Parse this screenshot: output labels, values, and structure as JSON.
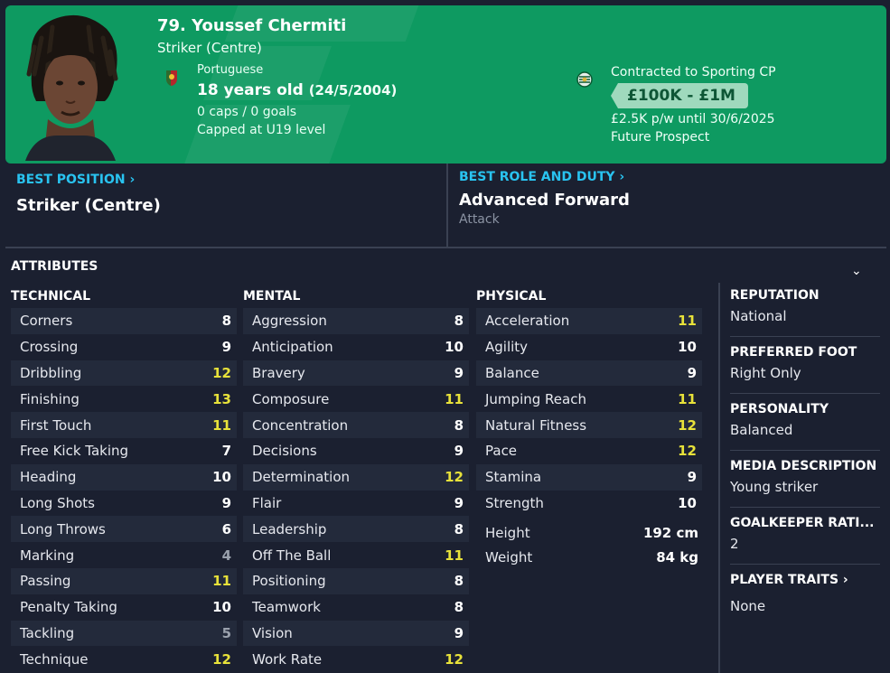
{
  "header": {
    "name": "79. Youssef Chermiti",
    "position": "Striker (Centre)",
    "nationality": "Portuguese",
    "age": "18 years old",
    "dob": "(24/5/2004)",
    "caps": "0 caps / 0 goals",
    "capped_level": "Capped at U19 level",
    "contract": "Contracted to Sporting CP",
    "value": "£100K - £1M",
    "wage": "£2.5K p/w until 30/6/2025",
    "status": "Future Prospect",
    "bg_color": "#0e9a61"
  },
  "best_position": {
    "title": "BEST POSITION",
    "value": "Striker (Centre)"
  },
  "best_role": {
    "title": "BEST ROLE AND DUTY",
    "value": "Advanced Forward",
    "duty": "Attack"
  },
  "attributes": {
    "title": "ATTRIBUTES",
    "technical": {
      "title": "TECHNICAL",
      "items": [
        {
          "label": "Corners",
          "value": "8"
        },
        {
          "label": "Crossing",
          "value": "9"
        },
        {
          "label": "Dribbling",
          "value": "12"
        },
        {
          "label": "Finishing",
          "value": "13"
        },
        {
          "label": "First Touch",
          "value": "11"
        },
        {
          "label": "Free Kick Taking",
          "value": "7"
        },
        {
          "label": "Heading",
          "value": "10"
        },
        {
          "label": "Long Shots",
          "value": "9"
        },
        {
          "label": "Long Throws",
          "value": "6"
        },
        {
          "label": "Marking",
          "value": "4"
        },
        {
          "label": "Passing",
          "value": "11"
        },
        {
          "label": "Penalty Taking",
          "value": "10"
        },
        {
          "label": "Tackling",
          "value": "5"
        },
        {
          "label": "Technique",
          "value": "12"
        }
      ]
    },
    "mental": {
      "title": "MENTAL",
      "items": [
        {
          "label": "Aggression",
          "value": "8"
        },
        {
          "label": "Anticipation",
          "value": "10"
        },
        {
          "label": "Bravery",
          "value": "9"
        },
        {
          "label": "Composure",
          "value": "11"
        },
        {
          "label": "Concentration",
          "value": "8"
        },
        {
          "label": "Decisions",
          "value": "9"
        },
        {
          "label": "Determination",
          "value": "12"
        },
        {
          "label": "Flair",
          "value": "9"
        },
        {
          "label": "Leadership",
          "value": "8"
        },
        {
          "label": "Off The Ball",
          "value": "11"
        },
        {
          "label": "Positioning",
          "value": "8"
        },
        {
          "label": "Teamwork",
          "value": "8"
        },
        {
          "label": "Vision",
          "value": "9"
        },
        {
          "label": "Work Rate",
          "value": "12"
        }
      ]
    },
    "physical": {
      "title": "PHYSICAL",
      "items": [
        {
          "label": "Acceleration",
          "value": "11"
        },
        {
          "label": "Agility",
          "value": "10"
        },
        {
          "label": "Balance",
          "value": "9"
        },
        {
          "label": "Jumping Reach",
          "value": "11"
        },
        {
          "label": "Natural Fitness",
          "value": "12"
        },
        {
          "label": "Pace",
          "value": "12"
        },
        {
          "label": "Stamina",
          "value": "9"
        },
        {
          "label": "Strength",
          "value": "10"
        }
      ],
      "height_label": "Height",
      "height": "192 cm",
      "weight_label": "Weight",
      "weight": "84 kg"
    }
  },
  "side": {
    "reputation_title": "REPUTATION",
    "reputation": "National",
    "foot_title": "PREFERRED FOOT",
    "foot": "Right Only",
    "personality_title": "PERSONALITY",
    "personality": "Balanced",
    "media_title": "MEDIA DESCRIPTION",
    "media": "Young striker",
    "gk_title": "GOALKEEPER RATI...",
    "gk": "2",
    "traits_title": "PLAYER TRAITS",
    "traits": "None"
  },
  "colors": {
    "highlight": "#e8e23a",
    "low": "#9aa1ad",
    "link": "#29c3f0"
  }
}
